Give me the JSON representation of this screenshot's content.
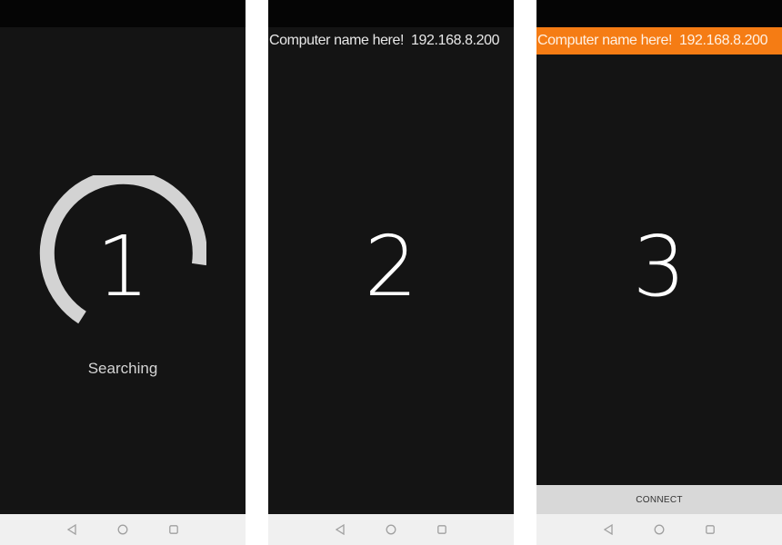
{
  "screens": [
    {
      "number": "1",
      "status_text": "Searching"
    },
    {
      "number": "2",
      "device": {
        "name": "Computer name here!",
        "ip": "192.168.8.200"
      }
    },
    {
      "number": "3",
      "device": {
        "name": "Computer name here!",
        "ip": "192.168.8.200"
      },
      "connect_label": "CONNECT"
    }
  ],
  "colors": {
    "screen_bg": "#141414",
    "status_bar": "#050505",
    "nav_bar": "#f0f0f0",
    "selected_row": "#f57c14",
    "spinner": "#d3d3d3",
    "connect_button": "#d8d8d8"
  },
  "nav_icons": [
    "back-triangle-icon",
    "home-circle-icon",
    "recents-square-icon"
  ]
}
